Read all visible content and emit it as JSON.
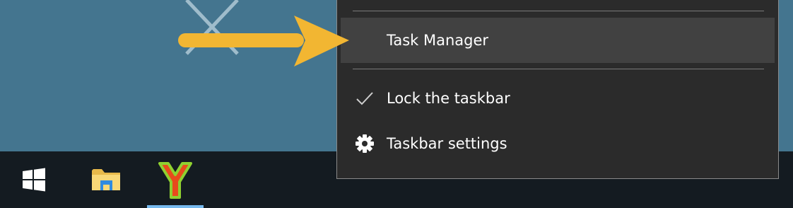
{
  "colors": {
    "desktop": "#44758f",
    "taskbar": "#141b21",
    "menu_background": "#2b2b2b",
    "menu_highlight": "#414141",
    "active_indicator": "#76b9ed",
    "annotation_arrow": "#f2b632"
  },
  "context_menu": {
    "items": [
      {
        "label": "Task Manager",
        "icon": "none",
        "highlighted": true
      },
      {
        "label": "Lock the taskbar",
        "icon": "checkmark-icon",
        "checked": true
      },
      {
        "label": "Taskbar settings",
        "icon": "gear-icon"
      }
    ]
  },
  "taskbar": {
    "buttons": [
      {
        "name": "start",
        "icon": "windows-logo-icon"
      },
      {
        "name": "file-explorer",
        "icon": "folder-icon"
      },
      {
        "name": "yandex-browser",
        "icon": "yandex-y-icon",
        "active": true
      }
    ]
  },
  "annotation": {
    "icon": "arrow-right-icon",
    "points_to": "Task Manager"
  }
}
